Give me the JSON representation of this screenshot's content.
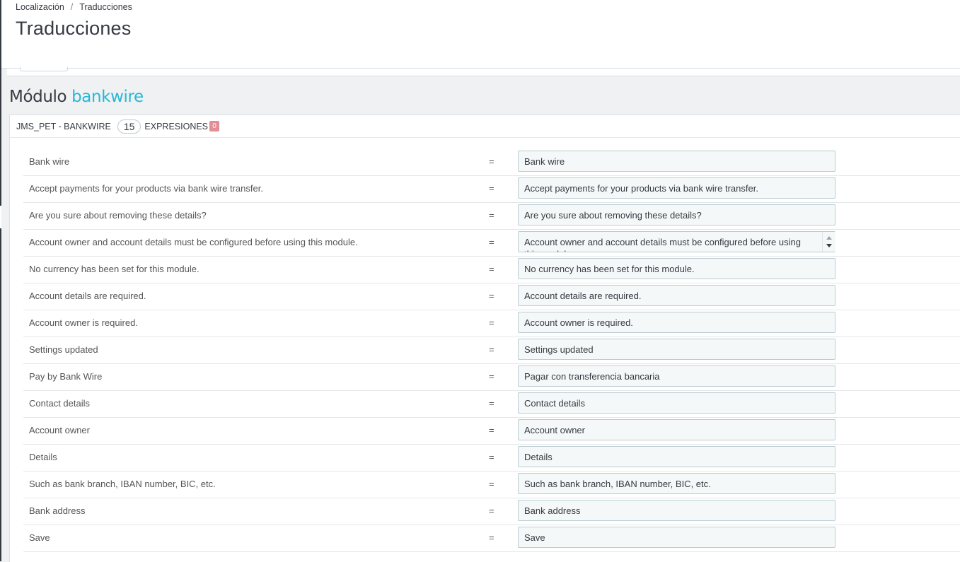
{
  "breadcrumb": {
    "parent": "Localización",
    "separator": "/",
    "current": "Traducciones"
  },
  "page_title": "Traducciones",
  "module": {
    "prefix": "Módulo",
    "name": "bankwire"
  },
  "panel": {
    "theme_label": "JMS_PET - BANKWIRE",
    "count": "15",
    "expressions_label": "EXPRESIONES",
    "missing_count": "0"
  },
  "equals_sign": "=",
  "rows": [
    {
      "source": "Bank wire",
      "translation": "Bank wire"
    },
    {
      "source": "Accept payments for your products via bank wire transfer.",
      "translation": "Accept payments for your products via bank wire transfer."
    },
    {
      "source": "Are you sure about removing these details?",
      "translation": "Are you sure about removing these details?"
    },
    {
      "source": "Account owner and account details must be configured before using this module.",
      "translation": "Account owner and account details must be configured before using this module."
    },
    {
      "source": "No currency has been set for this module.",
      "translation": "No currency has been set for this module."
    },
    {
      "source": "Account details are required.",
      "translation": "Account details are required."
    },
    {
      "source": "Account owner is required.",
      "translation": "Account owner is required."
    },
    {
      "source": "Settings updated",
      "translation": "Settings updated"
    },
    {
      "source": "Pay by Bank Wire",
      "translation": "Pagar con transferencia bancaria"
    },
    {
      "source": "Contact details",
      "translation": "Contact details"
    },
    {
      "source": "Account owner",
      "translation": "Account owner"
    },
    {
      "source": "Details",
      "translation": "Details"
    },
    {
      "source": "Such as bank branch, IBAN number, BIC, etc.",
      "translation": "Such as bank branch, IBAN number, BIC, etc."
    },
    {
      "source": "Bank address",
      "translation": "Bank address"
    },
    {
      "source": "Save",
      "translation": "Save"
    }
  ],
  "colors": {
    "accent": "#25b9d7",
    "badge_danger": "#e08f95",
    "input_bg": "#f5f8f9",
    "input_border": "#bbcdd2"
  }
}
